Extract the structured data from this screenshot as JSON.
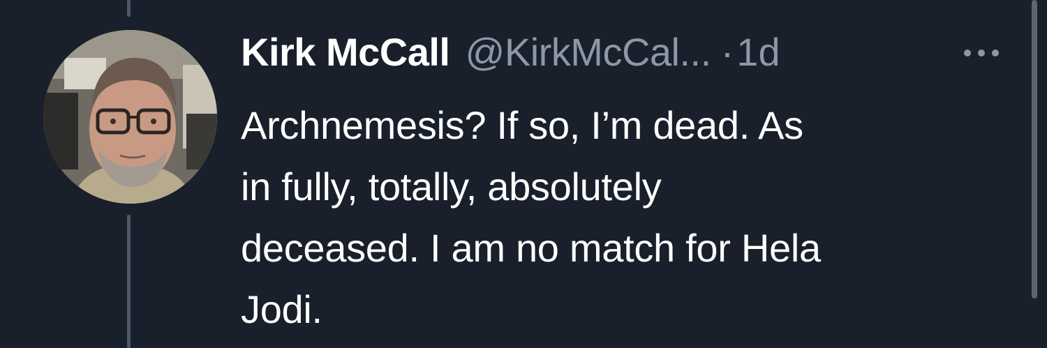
{
  "tweet": {
    "author_name": "Kirk McCall",
    "handle": "@KirkMcCal...",
    "separator": "·",
    "time": "1d",
    "more_icon": "more-horizontal-icon",
    "text_lines": [
      "Archnemesis? If so, I’m dead. As",
      "in fully, totally, absolutely",
      "deceased. I am no match for Hela",
      "Jodi."
    ]
  },
  "colors": {
    "background": "#19202b",
    "primary_text": "#ffffff",
    "secondary_text": "#8b98a5",
    "thread_line": "#4b5a6a"
  }
}
